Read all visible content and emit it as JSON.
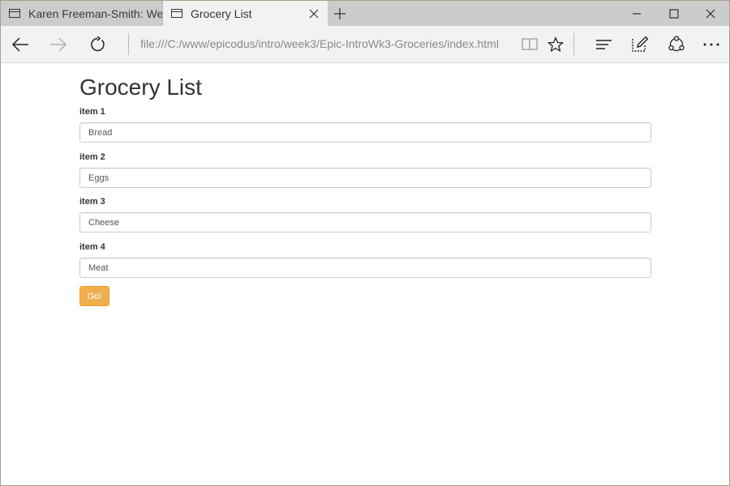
{
  "browser": {
    "tabs": [
      {
        "title": "Karen Freeman-Smith: Web",
        "active": false
      },
      {
        "title": "Grocery List",
        "active": true
      }
    ],
    "address": "file:///C:/www/epicodus/intro/week3/Epic-IntroWk3-Groceries/index.html",
    "icons": {
      "tab": "page-icon",
      "close_tab": "close-icon",
      "new_tab": "plus-icon",
      "back": "back-arrow-icon",
      "forward": "forward-arrow-icon",
      "refresh": "refresh-icon",
      "reading_view": "book-icon",
      "favorite": "star-icon",
      "hub": "hub-icon",
      "web_note": "pen-note-icon",
      "share": "share-icon",
      "more": "more-icon",
      "minimize": "minimize-icon",
      "maximize": "maximize-icon",
      "close_window": "close-icon"
    }
  },
  "page": {
    "title": "Grocery List",
    "fields": [
      {
        "label": "item 1",
        "value": "Bread"
      },
      {
        "label": "item 2",
        "value": "Eggs"
      },
      {
        "label": "item 3",
        "value": "Cheese"
      },
      {
        "label": "item 4",
        "value": "Meat"
      }
    ],
    "submit_label": "Go!"
  },
  "colors": {
    "submit_background": "#f0ad4e",
    "tab_bar": "#cccccc",
    "active_tab": "#f2f2f2"
  }
}
